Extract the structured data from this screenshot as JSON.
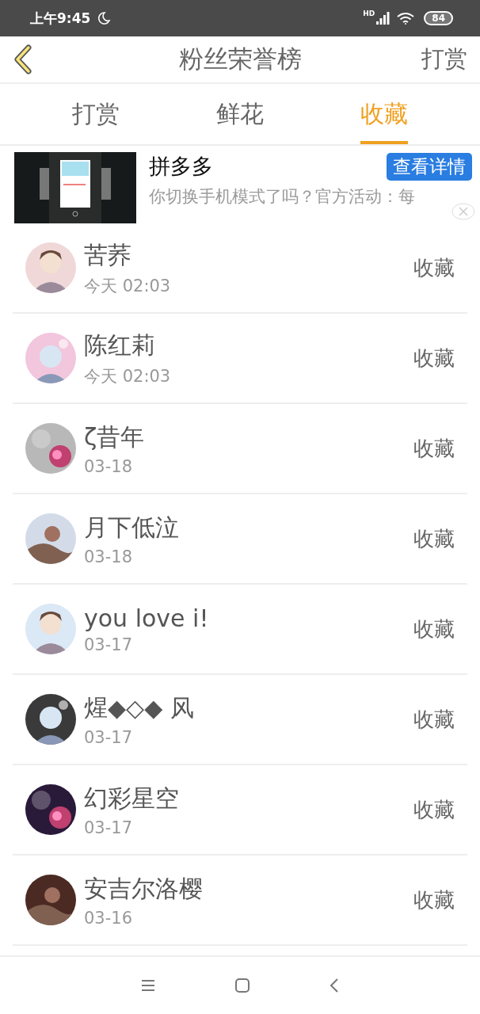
{
  "status_bar": {
    "time": "上午9:45",
    "network": "HD",
    "battery": "84"
  },
  "header": {
    "title": "粉丝荣誉榜",
    "action": "打赏"
  },
  "tabs": [
    {
      "label": "打赏",
      "selected": false
    },
    {
      "label": "鲜花",
      "selected": false
    },
    {
      "label": "收藏",
      "selected": true
    }
  ],
  "ad": {
    "title": "拼多多",
    "button": "查看详情",
    "text": "你切换手机模式了吗？官方活动：每"
  },
  "fans": [
    {
      "name": "苦荞",
      "time": "今天 02:03",
      "action": "收藏"
    },
    {
      "name": "陈红莉",
      "time": "今天 02:03",
      "action": "收藏"
    },
    {
      "name": "ζ昔年",
      "time": "03-18",
      "action": "收藏"
    },
    {
      "name": "月下低泣",
      "time": "03-18",
      "action": "收藏"
    },
    {
      "name": "you love i!",
      "time": "03-17",
      "action": "收藏"
    },
    {
      "name": "煋◆◇◆ 风",
      "time": "03-17",
      "action": "收藏"
    },
    {
      "name": "幻彩星空",
      "time": "03-17",
      "action": "收藏"
    },
    {
      "name": "安吉尔洛樱",
      "time": "03-16",
      "action": "收藏"
    }
  ]
}
